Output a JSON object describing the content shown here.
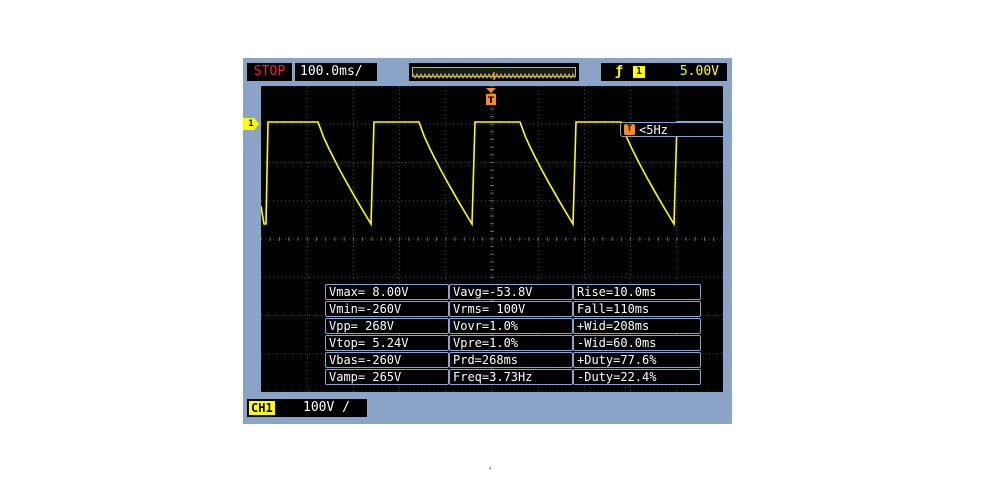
{
  "status": {
    "run_state": "STOP",
    "timebase": "100.0ms/"
  },
  "trigger": {
    "slope_icon": "rising-edge-icon",
    "source_channel": "1",
    "level": "5.00V",
    "marker_label": "T",
    "frequency": "<5Hz"
  },
  "channel": {
    "id": "1",
    "label": "CH1",
    "scale": "100V /",
    "color": "#ffff00"
  },
  "colors": {
    "trace": "#ffff00",
    "trigger": "#ff8c1a",
    "stop": "#ff2020",
    "frame": "#8aa4c8",
    "grid": "#4a4a4a"
  },
  "measurements": [
    [
      "Vmax= 8.00V",
      "Vavg=-53.8V",
      "Rise=10.0ms"
    ],
    [
      "Vmin=-260V",
      "Vrms= 100V",
      "Fall=110ms"
    ],
    [
      "Vpp= 268V",
      "Vovr=1.0%",
      "+Wid=208ms"
    ],
    [
      "Vtop= 5.24V",
      "Vpre=1.0%",
      "-Wid=60.0ms"
    ],
    [
      "Vbas=-260V",
      "Prd=268ms",
      "+Duty=77.6%"
    ],
    [
      "Vamp= 265V",
      "Freq=3.73Hz",
      "-Duty=22.4%"
    ]
  ],
  "footer_mark": "'"
}
